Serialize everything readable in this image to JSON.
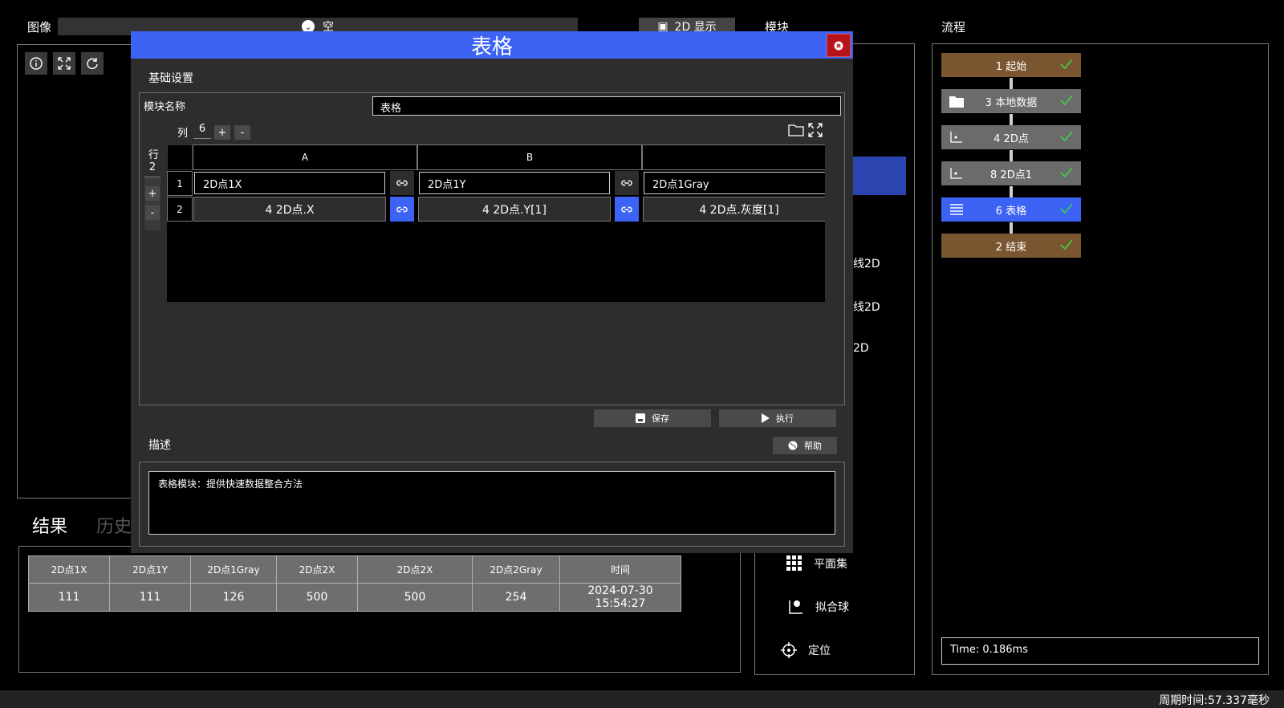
{
  "image_panel": {
    "label": "图像",
    "source_value": "空",
    "display_button": "2D 显示"
  },
  "module_panel": {
    "label": "模块",
    "items": [
      {
        "label": "线2D"
      },
      {
        "label": "线2D"
      },
      {
        "label": "2D"
      },
      {
        "label": "平面集",
        "icon": "grid-icon"
      },
      {
        "label": "拟合球",
        "icon": "sphere-fit-icon"
      },
      {
        "label": "定位",
        "icon": "crosshair-icon"
      }
    ]
  },
  "flow_panel": {
    "label": "流程",
    "nodes": [
      {
        "label": "1 起始",
        "color": "#7a5630"
      },
      {
        "label": "3 本地数据",
        "color": "#6b6b6b",
        "icon": "folder-icon"
      },
      {
        "label": "4 2D点",
        "color": "#6b6b6b",
        "icon": "point-plot-icon"
      },
      {
        "label": "8 2D点1",
        "color": "#6b6b6b",
        "icon": "point-plot-icon"
      },
      {
        "label": "6 表格",
        "color": "#3d63f4",
        "icon": "table-list-icon"
      },
      {
        "label": "2 结束",
        "color": "#7a5630"
      }
    ],
    "time": "Time: 0.186ms"
  },
  "results": {
    "tab_active": "结果",
    "tab_inactive": "历史",
    "headers": [
      "2D点1X",
      "2D点1Y",
      "2D点1Gray",
      "2D点2X",
      "2D点2X",
      "2D点2Gray",
      "时间"
    ],
    "row": [
      "111",
      "111",
      "126",
      "500",
      "500",
      "254",
      "2024-07-30 15:54:27"
    ]
  },
  "status_bar": {
    "cycle_time": "周期时间:57.337毫秒"
  },
  "dialog": {
    "title": "表格",
    "basic_settings": "基础设置",
    "module_name_label": "模块名称",
    "module_name_value": "表格",
    "col_label": "列",
    "col_count": "6",
    "row_label": "行",
    "row_count": "2",
    "plus": "+",
    "minus": "-",
    "col_headers": [
      "A",
      "B"
    ],
    "rows": [
      {
        "num": "1",
        "cells": [
          "2D点1X",
          "2D点1Y",
          "2D点1Gray"
        ]
      },
      {
        "num": "2",
        "cells": [
          "4 2D点.X",
          "4 2D点.Y[1]",
          "4 2D点.灰度[1]"
        ]
      }
    ],
    "save_label": "保存",
    "run_label": "执行",
    "description_label": "描述",
    "help_label": "帮助",
    "description_text": "表格模块：提供快速数据整合方法"
  }
}
